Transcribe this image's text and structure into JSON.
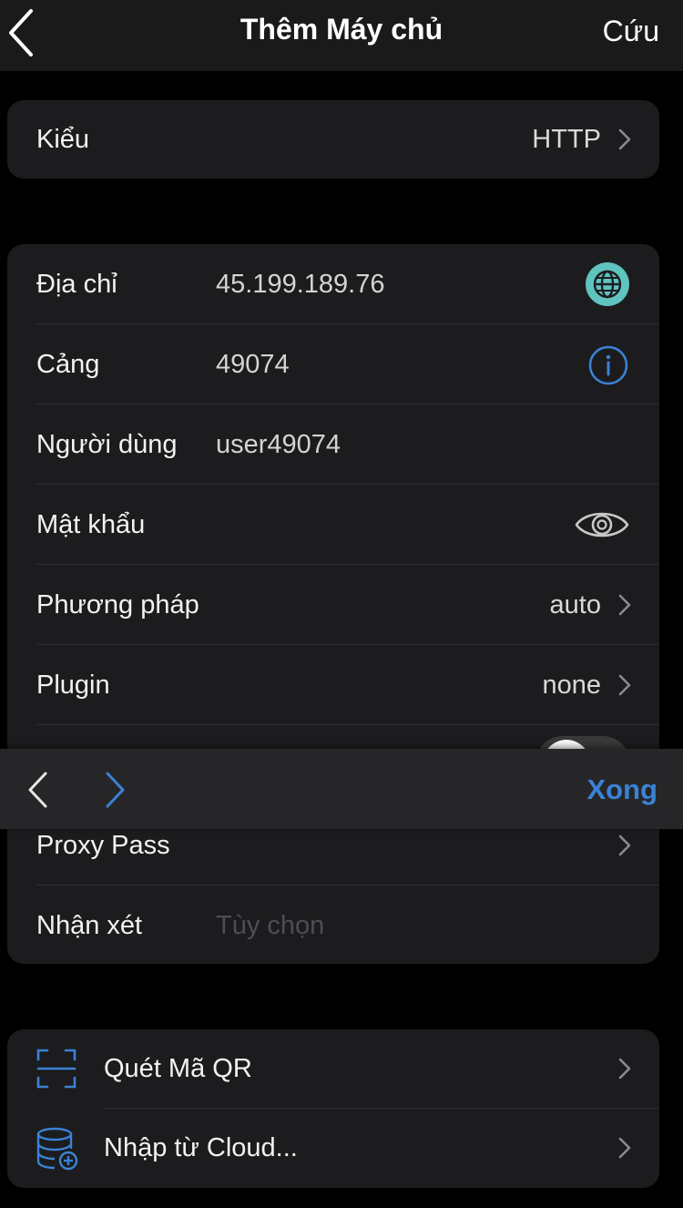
{
  "nav": {
    "title": "Thêm Máy chủ",
    "save_label": "Cứu"
  },
  "type_row": {
    "label": "Kiểu",
    "value": "HTTP"
  },
  "server": {
    "address": {
      "label": "Địa chỉ",
      "value": "45.199.189.76"
    },
    "port": {
      "label": "Cảng",
      "value": "49074"
    },
    "user": {
      "label": "Người dùng",
      "value": "user49074"
    },
    "password": {
      "label": "Mật khẩu",
      "value": ""
    },
    "method": {
      "label": "Phương pháp",
      "value": "auto"
    },
    "plugin": {
      "label": "Plugin",
      "value": "none"
    },
    "proxy_pass": {
      "label": "Proxy Pass"
    },
    "comment": {
      "label": "Nhận xét",
      "placeholder": "Tùy chọn"
    }
  },
  "keyboard_toolbar": {
    "done_label": "Xong"
  },
  "actions": {
    "scan_qr": "Quét Mã QR",
    "import_cloud": "Nhập từ Cloud..."
  },
  "colors": {
    "accent": "#3b82d6",
    "globe_icon": "#5fc3c0",
    "card_bg": "#1c1c1e",
    "background": "#000000"
  }
}
